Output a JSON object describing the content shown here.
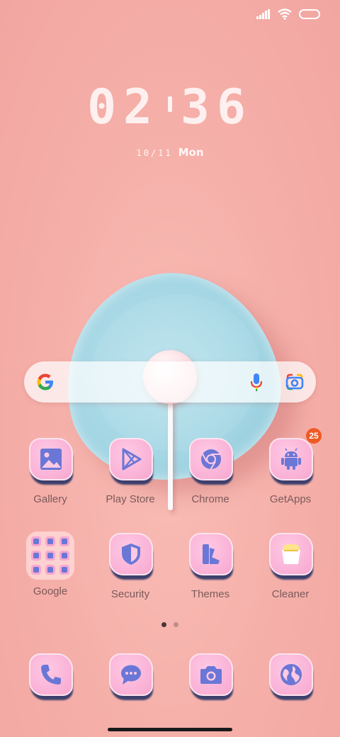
{
  "clock": {
    "hours": "02",
    "minutes": "36"
  },
  "date": {
    "numeric": "10/11",
    "weekday": "Mon"
  },
  "apps_row1": [
    {
      "label": "Gallery",
      "icon": "gallery-icon"
    },
    {
      "label": "Play Store",
      "icon": "play-store-icon"
    },
    {
      "label": "Chrome",
      "icon": "chrome-icon"
    },
    {
      "label": "GetApps",
      "icon": "android-icon",
      "badge": "25"
    }
  ],
  "apps_row2": [
    {
      "label": "Google",
      "icon": "folder-icon"
    },
    {
      "label": "Security",
      "icon": "shield-icon"
    },
    {
      "label": "Themes",
      "icon": "themes-icon"
    },
    {
      "label": "Cleaner",
      "icon": "cleaner-icon"
    }
  ],
  "dock": [
    {
      "icon": "phone-icon"
    },
    {
      "icon": "messages-icon"
    },
    {
      "icon": "camera-icon"
    },
    {
      "icon": "browser-icon"
    }
  ],
  "colors": {
    "icon_glyph": "#6b77d6",
    "badge": "#ee5a24",
    "wallpaper": "#f6b3ad"
  }
}
